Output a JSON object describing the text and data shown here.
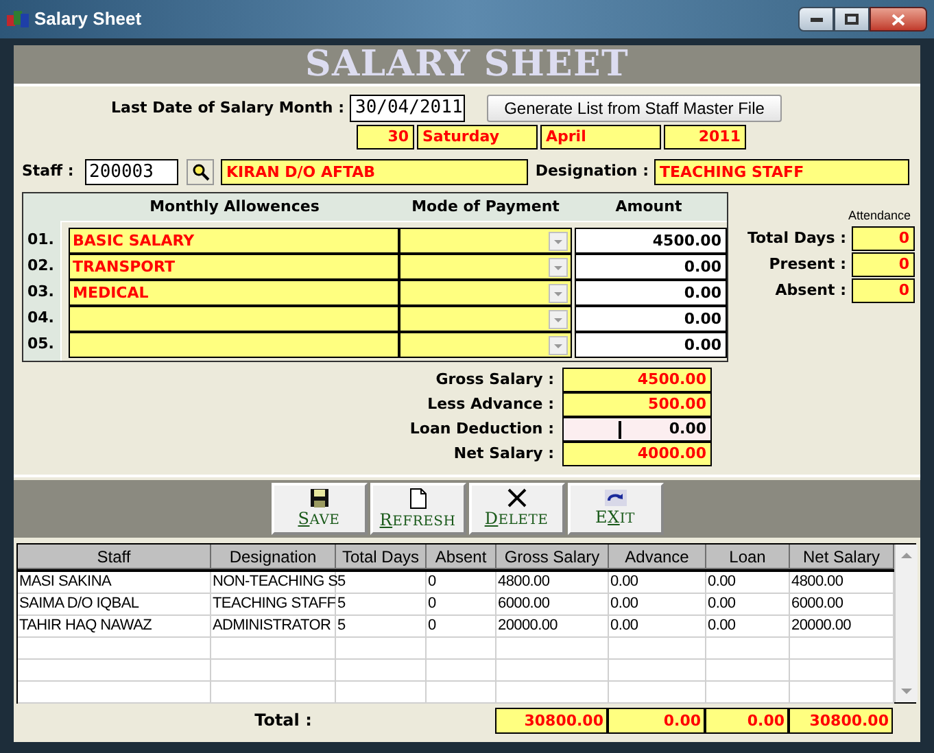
{
  "window": {
    "title": "Salary Sheet"
  },
  "header": {
    "title": "SALARY SHEET"
  },
  "salary_date": {
    "label": "Last Date of Salary Month :",
    "value": "30/04/2011"
  },
  "generate_button": {
    "label": "Generate List from Staff Master File"
  },
  "date_parts": [
    "30",
    "Saturday",
    "April",
    "2011"
  ],
  "staff": {
    "label": "Staff :",
    "code": "200003",
    "name": "KIRAN D/O AFTAB"
  },
  "designation": {
    "label": "Designation :",
    "value": "TEACHING STAFF"
  },
  "allowances": {
    "columns": [
      "Monthly Allowences",
      "Mode of Payment",
      "Amount"
    ],
    "rows": [
      {
        "number": "01.",
        "name": "BASIC SALARY",
        "amount": "4500.00"
      },
      {
        "number": "02.",
        "name": "TRANSPORT",
        "amount": "0.00"
      },
      {
        "number": "03.",
        "name": "MEDICAL",
        "amount": "0.00"
      },
      {
        "number": "04.",
        "amount": "0.00"
      },
      {
        "number": "05.",
        "amount": "0.00"
      }
    ]
  },
  "attendance": {
    "title": "Attendance",
    "items": [
      {
        "label": "Total Days :",
        "value": "0"
      },
      {
        "label": "Present :",
        "value": "0"
      },
      {
        "label": "Absent :",
        "value": "0"
      }
    ]
  },
  "summary": [
    {
      "label": "Gross Salary :",
      "value": "4500.00",
      "kind": "computed"
    },
    {
      "label": "Less Advance :",
      "value": "500.00",
      "kind": "computed"
    },
    {
      "label": "Loan Deduction :",
      "value": "0.00",
      "kind": "input"
    },
    {
      "label": "Net Salary :",
      "value": "4000.00",
      "kind": "computed"
    }
  ],
  "toolbar": [
    {
      "kind": "save",
      "key": "S",
      "after": "AVE"
    },
    {
      "kind": "refresh",
      "key": "R",
      "after": "EFRESH"
    },
    {
      "kind": "delete",
      "key": "D",
      "after": "ELETE"
    },
    {
      "kind": "exit",
      "before": "E",
      "key": "X",
      "after": "IT"
    }
  ],
  "table": {
    "columns": [
      "Staff",
      "Designation",
      "Total Days",
      "Absent",
      "Gross Salary",
      "Advance",
      "Loan",
      "Net Salary"
    ],
    "rows": [
      [
        "MASI SAKINA",
        "NON-TEACHING S",
        "5",
        "0",
        "4800.00",
        "0.00",
        "0.00",
        "4800.00"
      ],
      [
        "SAIMA D/O IQBAL",
        "TEACHING STAFF",
        "5",
        "0",
        "6000.00",
        "0.00",
        "0.00",
        "6000.00"
      ],
      [
        "TAHIR HAQ NAWAZ",
        "ADMINISTRATOR",
        "5",
        "0",
        "20000.00",
        "0.00",
        "0.00",
        "20000.00"
      ]
    ]
  },
  "totals": {
    "label": "Total :",
    "values": [
      "30800.00",
      "0.00",
      "0.00",
      "30800.00"
    ]
  }
}
